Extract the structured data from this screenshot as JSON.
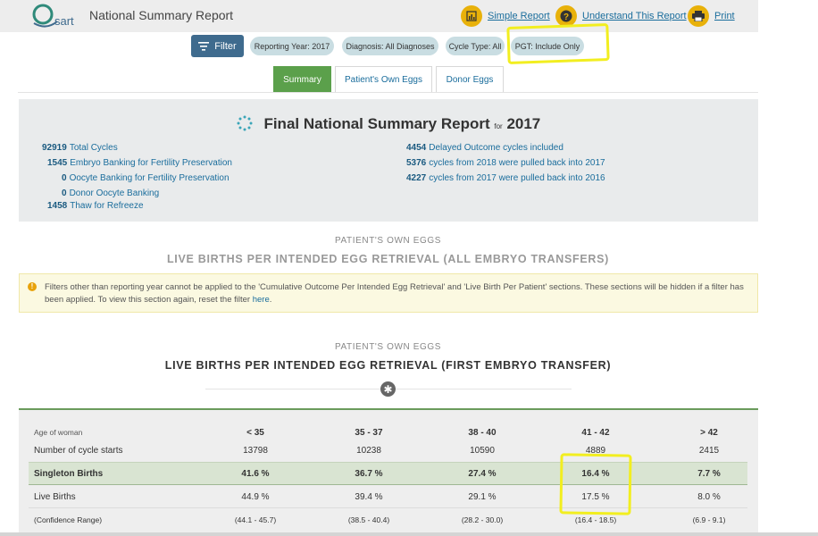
{
  "header": {
    "logo_text": "sart",
    "title": "National Summary Report",
    "links": [
      "Simple Report",
      "Understand This Report",
      "Print"
    ]
  },
  "filter_bar": {
    "filter_label": "Filter",
    "chips": [
      "Reporting Year: 2017",
      "Diagnosis: All Diagnoses",
      "Cycle Type: All",
      "PGT: Include Only"
    ]
  },
  "tabs": [
    "Summary",
    "Patient's Own Eggs",
    "Donor Eggs"
  ],
  "summary": {
    "title": "Final National Summary Report",
    "for_word": "for",
    "year": "2017",
    "left_stats": [
      {
        "num": "92919",
        "label": "Total Cycles"
      },
      {
        "num": "1545",
        "label": "Embryo Banking for Fertility Preservation"
      },
      {
        "num": "0",
        "label": "Oocyte Banking for Fertility Preservation"
      },
      {
        "num": "0",
        "label": "Donor Oocyte Banking"
      },
      {
        "num": "1458",
        "label": "Thaw for Refreeze"
      }
    ],
    "right_stats": [
      {
        "num": "4454",
        "label": "Delayed Outcome cycles included"
      },
      {
        "num": "5376",
        "label": "cycles from 2018 were pulled back into 2017"
      },
      {
        "num": "4227",
        "label": "cycles from 2017 were pulled back into 2016"
      }
    ]
  },
  "section1": {
    "subtitle": "PATIENT'S OWN EGGS",
    "title": "LIVE BIRTHS PER INTENDED EGG RETRIEVAL (ALL EMBRYO TRANSFERS)"
  },
  "notice": {
    "text": "Filters other than reporting year cannot be applied to the 'Cumulative Outcome Per Intended Egg Retrieval' and 'Live Birth Per Patient' sections. These sections will be hidden if a filter has been applied. To view this section again, reset the filter",
    "link": "here",
    "end": "."
  },
  "section2": {
    "subtitle": "PATIENT'S OWN EGGS",
    "title": "LIVE BIRTHS PER INTENDED EGG RETRIEVAL (FIRST EMBRYO TRANSFER)"
  },
  "table": {
    "header_label": "Age of woman",
    "columns": [
      "< 35",
      "35 - 37",
      "38 - 40",
      "41 - 42",
      "> 42"
    ],
    "rows": [
      {
        "label": "Number of cycle starts",
        "values": [
          "13798",
          "10238",
          "10590",
          "4889",
          "2415"
        ]
      },
      {
        "label": "Singleton Births",
        "values": [
          "41.6 %",
          "36.7 %",
          "27.4 %",
          "16.4 %",
          "7.7 %"
        ]
      },
      {
        "label": "Live Births",
        "values": [
          "44.9 %",
          "39.4 %",
          "29.1 %",
          "17.5 %",
          "8.0 %"
        ]
      },
      {
        "label": "(Confidence Range)",
        "values": [
          "(44.1 - 45.7)",
          "(38.5 - 40.4)",
          "(28.2 - 30.0)",
          "(16.4 - 18.5)",
          "(6.9 - 9.1)"
        ]
      }
    ]
  },
  "colors": {
    "highlight_annotation": "#f2ee20",
    "active_tab": "#5ba04b",
    "filter_button": "#3f6b8e",
    "link": "#1a6d9c",
    "icon_circle": "#e8b10a"
  }
}
